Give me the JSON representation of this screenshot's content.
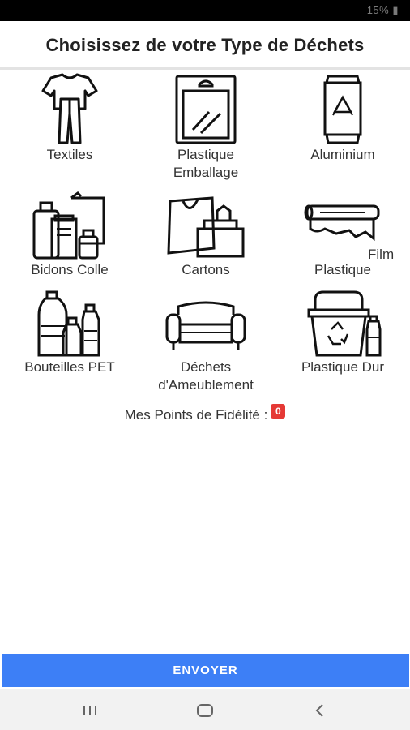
{
  "status_bar": {
    "text": "15% ▮"
  },
  "header": {
    "title": "Choisissez de votre Type de Déchets"
  },
  "categories": [
    {
      "label": "Textiles",
      "icon": "textiles-icon"
    },
    {
      "label": "Plastique\nEmballage",
      "icon": "plastic-packaging-icon"
    },
    {
      "label": "Aluminium",
      "icon": "aluminium-can-icon"
    },
    {
      "label": "Bidons Colle",
      "icon": "glue-cans-icon"
    },
    {
      "label": "Cartons",
      "icon": "cartons-icon"
    },
    {
      "label": "Plastique",
      "icon": "plastic-film-icon"
    },
    {
      "label": "Bouteilles PET",
      "icon": "pet-bottles-icon"
    },
    {
      "label": "Déchets\nd'Ameublement",
      "icon": "furniture-icon"
    },
    {
      "label": "Plastique Dur",
      "icon": "hard-plastic-icon"
    }
  ],
  "film_label": "Film",
  "loyalty": {
    "label": "Mes Points de Fidélité :",
    "points": "0"
  },
  "footer": {
    "send_label": "ENVOYER"
  },
  "nav": {
    "recents": "recents-icon",
    "home": "home-icon",
    "back": "back-icon"
  },
  "colors": {
    "accent": "#3d7ff6",
    "badge": "#e53935"
  }
}
